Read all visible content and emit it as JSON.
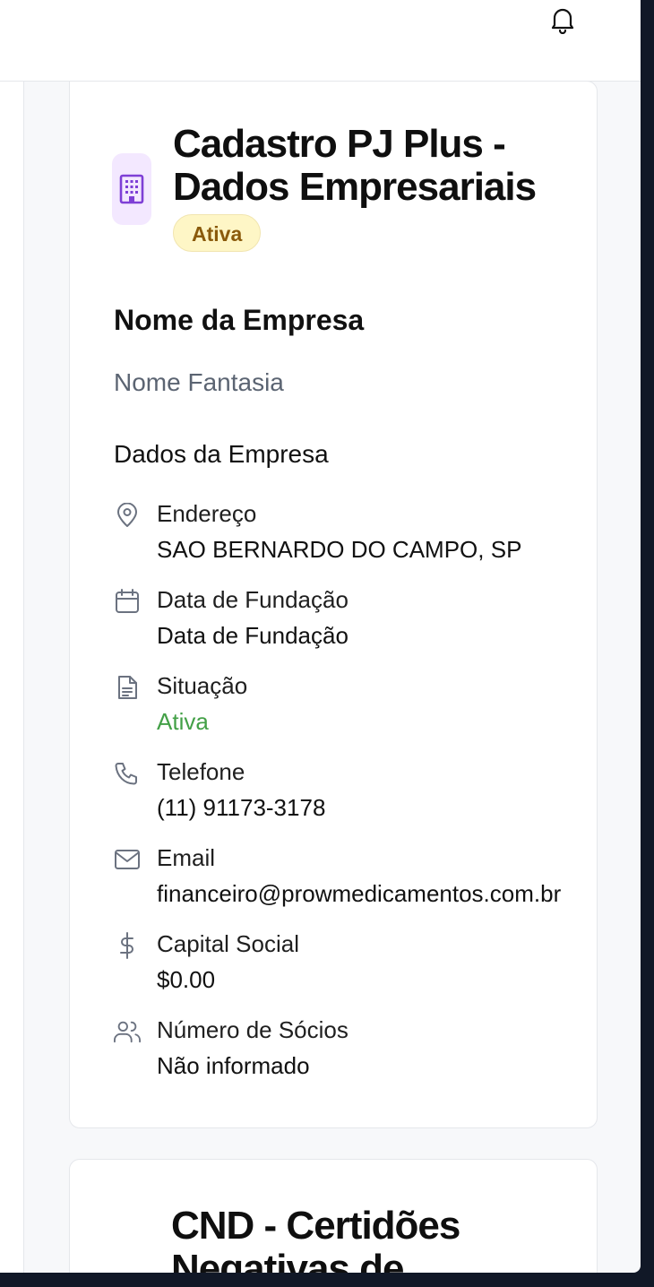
{
  "card_primary": {
    "title": "Cadastro PJ Plus - Dados Empresariais",
    "status_badge": "Ativa",
    "company_name": "Nome da Empresa",
    "trade_name": "Nome Fantasia",
    "section_title": "Dados da Empresa",
    "fields": [
      {
        "icon": "map-pin-icon",
        "label": "Endereço",
        "value": "SAO BERNARDO DO CAMPO, SP"
      },
      {
        "icon": "calendar-icon",
        "label": "Data de Fundação",
        "value": "Data de Fundação"
      },
      {
        "icon": "document-icon",
        "label": "Situação",
        "value": "Ativa"
      },
      {
        "icon": "phone-icon",
        "label": "Telefone",
        "value": "(11) 91173-3178"
      },
      {
        "icon": "mail-icon",
        "label": "Email",
        "value": "financeiro@prowmedicamentos.com.br"
      },
      {
        "icon": "dollar-icon",
        "label": "Capital Social",
        "value": "$0.00"
      },
      {
        "icon": "users-icon",
        "label": "Número de Sócios",
        "value": "Não informado"
      }
    ]
  },
  "card_secondary": {
    "title": "CND - Certidões Negativas de"
  },
  "colors": {
    "accent_purple": "#7e3fd6",
    "badge_yellow_bg": "#fef6c6",
    "badge_text": "#8a5a0b",
    "status_green": "#43a047"
  }
}
